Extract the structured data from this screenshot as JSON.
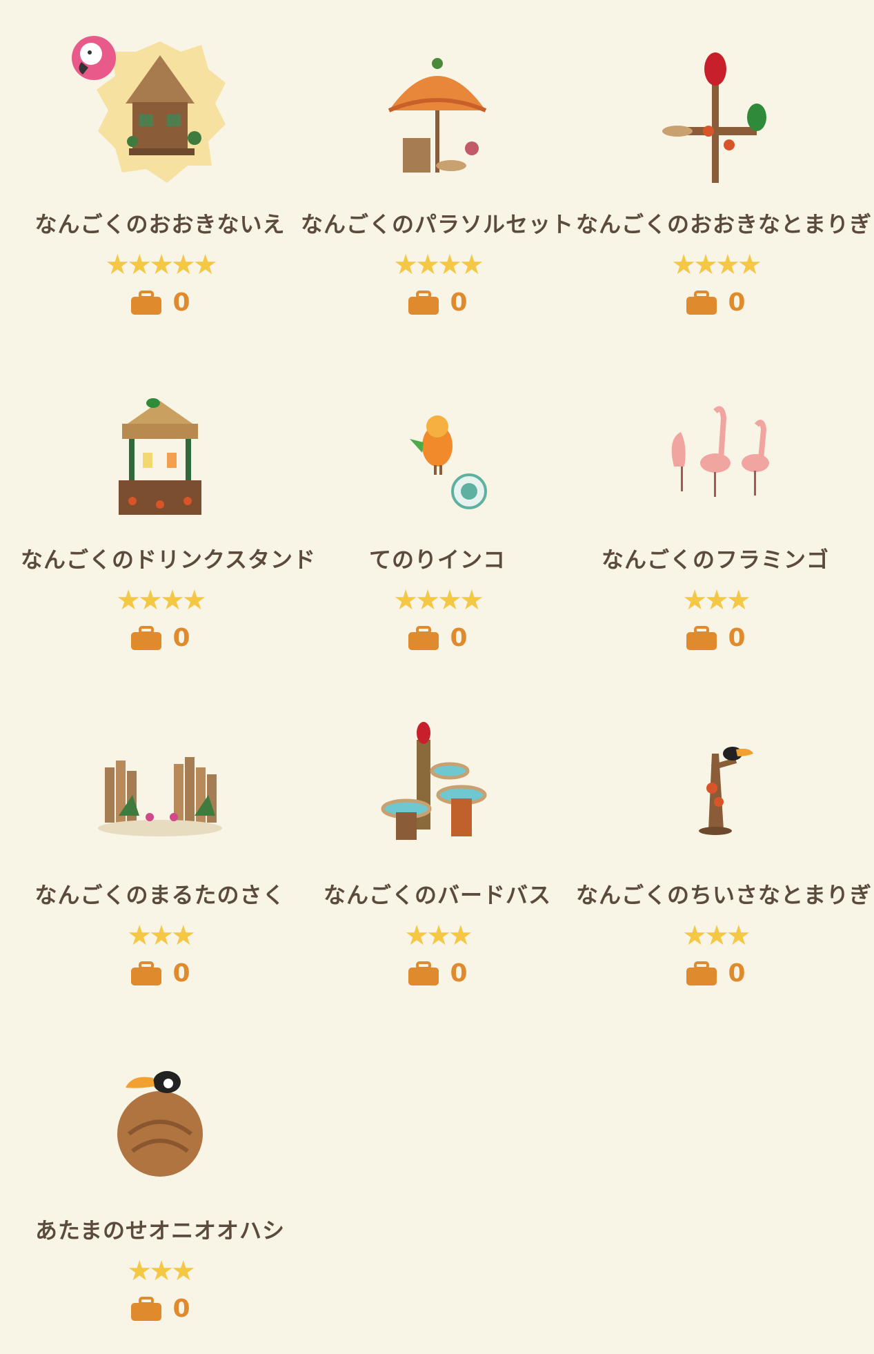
{
  "items": [
    {
      "name": "なんごくのおおきないえ",
      "stars": "★★★★★",
      "count": "0",
      "icon": "tropical-big-house-icon",
      "badge": "flamingo-badge-icon"
    },
    {
      "name": "なんごくのパラソルセット",
      "stars": "★★★★",
      "count": "0",
      "icon": "tropical-parasol-set-icon"
    },
    {
      "name": "なんごくのおおきなとまりぎ",
      "stars": "★★★★",
      "count": "0",
      "icon": "tropical-big-perch-icon"
    },
    {
      "name": "なんごくのドリンクスタンド",
      "stars": "★★★★",
      "count": "0",
      "icon": "tropical-drink-stand-icon"
    },
    {
      "name": "てのりインコ",
      "stars": "★★★★",
      "count": "0",
      "icon": "hand-parakeet-icon",
      "badge": "craft-badge-icon"
    },
    {
      "name": "なんごくのフラミンゴ",
      "stars": "★★★",
      "count": "0",
      "icon": "tropical-flamingo-icon"
    },
    {
      "name": "なんごくのまるたのさく",
      "stars": "★★★",
      "count": "0",
      "icon": "tropical-log-fence-icon"
    },
    {
      "name": "なんごくのバードバス",
      "stars": "★★★",
      "count": "0",
      "icon": "tropical-bird-bath-icon"
    },
    {
      "name": "なんごくのちいさなとまりぎ",
      "stars": "★★★",
      "count": "0",
      "icon": "tropical-small-perch-icon"
    },
    {
      "name": "あたまのせオニオオハシ",
      "stars": "★★★",
      "count": "0",
      "icon": "toucan-head-icon"
    }
  ],
  "colors": {
    "background": "#f8f4e6",
    "star": "#f4c744",
    "bag": "#e08a2e",
    "text": "#5b4b3c"
  }
}
